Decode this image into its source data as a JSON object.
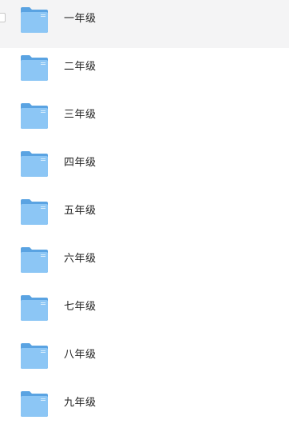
{
  "folders": [
    {
      "name": "一年级",
      "icon": "folder-icon"
    },
    {
      "name": "二年级",
      "icon": "folder-icon"
    },
    {
      "name": "三年级",
      "icon": "folder-icon"
    },
    {
      "name": "四年级",
      "icon": "folder-icon"
    },
    {
      "name": "五年级",
      "icon": "folder-icon"
    },
    {
      "name": "六年级",
      "icon": "folder-icon"
    },
    {
      "name": "七年级",
      "icon": "folder-icon"
    },
    {
      "name": "八年级",
      "icon": "folder-icon"
    },
    {
      "name": "九年级",
      "icon": "folder-icon"
    }
  ],
  "colors": {
    "hover_row": "#f4f4f5",
    "folder_back": "#6aaee8",
    "folder_front": "#8ec8f6",
    "text": "#222222"
  }
}
